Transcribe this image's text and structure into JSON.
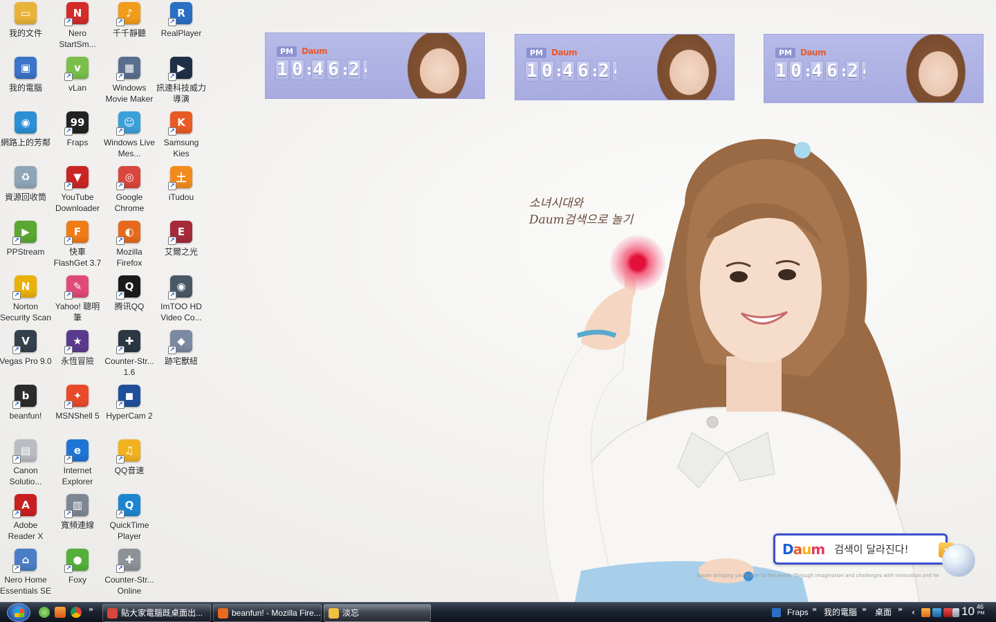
{
  "desktop": {
    "icons": [
      {
        "label": "我的文件",
        "icon": "my-documents-icon",
        "color": "#e9b33a",
        "glyph": "▭",
        "shortcut": false
      },
      {
        "label": "我的電腦",
        "icon": "my-computer-icon",
        "color": "#3b74c8",
        "glyph": "▣",
        "shortcut": false
      },
      {
        "label": "網路上的芳鄰",
        "icon": "network-places-icon",
        "color": "#2d8fd5",
        "glyph": "◉",
        "shortcut": false
      },
      {
        "label": "資源回收筒",
        "icon": "recycle-bin-icon",
        "color": "#8fa5b6",
        "glyph": "♻",
        "shortcut": false
      },
      {
        "label": "PPStream",
        "icon": "ppstream-icon",
        "color": "#5aa832",
        "glyph": "▶",
        "shortcut": true
      },
      {
        "label": "Norton Security Scan",
        "icon": "norton-icon",
        "color": "#e8b20a",
        "glyph": "N",
        "shortcut": true
      },
      {
        "label": "Vegas Pro 9.0",
        "icon": "vegas-icon",
        "color": "#35404d",
        "glyph": "V",
        "shortcut": true
      },
      {
        "label": "beanfun!",
        "icon": "beanfun-icon",
        "color": "#2b2b2b",
        "glyph": "b",
        "shortcut": true
      },
      {
        "label": "Canon Solutio...",
        "icon": "canon-icon",
        "color": "#b9bcc2",
        "glyph": "▤",
        "shortcut": true
      },
      {
        "label": "Adobe Reader X",
        "icon": "adobe-reader-icon",
        "color": "#c81f1f",
        "glyph": "A",
        "shortcut": true
      },
      {
        "label": "Nero Home Essentials SE",
        "icon": "nero-home-icon",
        "color": "#4a7ec7",
        "glyph": "⌂",
        "shortcut": true
      },
      {
        "label": "Nero StartSm...",
        "icon": "nero-icon",
        "color": "#d42b2b",
        "glyph": "N",
        "shortcut": true
      },
      {
        "label": "vLan",
        "icon": "vlan-icon",
        "color": "#7abf4a",
        "glyph": "v",
        "shortcut": true
      },
      {
        "label": "Fraps",
        "icon": "fraps-icon",
        "color": "#222222",
        "glyph": "99",
        "shortcut": true
      },
      {
        "label": "YouTube Downloader",
        "icon": "youtube-downloader-icon",
        "color": "#c92525",
        "glyph": "▼",
        "shortcut": true
      },
      {
        "label": "快車 FlashGet 3.7",
        "icon": "flashget-icon",
        "color": "#f07c16",
        "glyph": "F",
        "shortcut": true
      },
      {
        "label": "Yahoo! 聰明筆",
        "icon": "yahoo-pen-icon",
        "color": "#e04a7a",
        "glyph": "✎",
        "shortcut": true
      },
      {
        "label": "永恆冒險",
        "icon": "eternal-adventure-icon",
        "color": "#5a3a8c",
        "glyph": "★",
        "shortcut": true
      },
      {
        "label": "MSNShell 5",
        "icon": "msnshell-icon",
        "color": "#e84a2a",
        "glyph": "✦",
        "shortcut": true
      },
      {
        "label": "Internet Explorer",
        "icon": "internet-explorer-icon",
        "color": "#1f74d6",
        "glyph": "e",
        "shortcut": true
      },
      {
        "label": "寬頻連線",
        "icon": "broadband-icon",
        "color": "#7d8794",
        "glyph": "▥",
        "shortcut": true
      },
      {
        "label": "Foxy",
        "icon": "foxy-icon",
        "color": "#55b03a",
        "glyph": "●",
        "shortcut": true
      },
      {
        "label": "千千靜聽",
        "icon": "ttplayer-icon",
        "color": "#f29c1c",
        "glyph": "♪",
        "shortcut": true
      },
      {
        "label": "Windows Movie Maker",
        "icon": "movie-maker-icon",
        "color": "#5a6f8d",
        "glyph": "▦",
        "shortcut": true
      },
      {
        "label": "Windows Live Mes...",
        "icon": "live-messenger-icon",
        "color": "#3aa0d8",
        "glyph": "☺",
        "shortcut": true
      },
      {
        "label": "Google Chrome",
        "icon": "chrome-icon",
        "color": "#d9463b",
        "glyph": "◎",
        "shortcut": true
      },
      {
        "label": "Mozilla Firefox",
        "icon": "firefox-icon",
        "color": "#e66a1e",
        "glyph": "◐",
        "shortcut": true
      },
      {
        "label": "腾讯QQ",
        "icon": "qq-icon",
        "color": "#1b1b1b",
        "glyph": "Q",
        "shortcut": true
      },
      {
        "label": "Counter-Str... 1.6",
        "icon": "counter-strike-icon",
        "color": "#2c3744",
        "glyph": "✚",
        "shortcut": true
      },
      {
        "label": "HyperCam 2",
        "icon": "hypercam-icon",
        "color": "#1f4f9a",
        "glyph": "◼",
        "shortcut": true
      },
      {
        "label": "QQ音速",
        "icon": "qq-speed-icon",
        "color": "#f1b220",
        "glyph": "♫",
        "shortcut": true
      },
      {
        "label": "QuickTime Player",
        "icon": "quicktime-icon",
        "color": "#1d86d2",
        "glyph": "Q",
        "shortcut": true
      },
      {
        "label": "Counter-Str... Online",
        "icon": "cs-online-icon",
        "color": "#8d9298",
        "glyph": "✚",
        "shortcut": true
      },
      {
        "label": "RealPlayer",
        "icon": "realplayer-icon",
        "color": "#2a6fc4",
        "glyph": "R",
        "shortcut": true
      },
      {
        "label": "訊連科技威力導演",
        "icon": "powerdirector-icon",
        "color": "#1f2f45",
        "glyph": "▶",
        "shortcut": true
      },
      {
        "label": "Samsung Kies",
        "icon": "samsung-kies-icon",
        "color": "#ea5a25",
        "glyph": "K",
        "shortcut": true
      },
      {
        "label": "iTudou",
        "icon": "itudou-icon",
        "color": "#f28b1d",
        "glyph": "土",
        "shortcut": true
      },
      {
        "label": "艾爾之光",
        "icon": "elsword-icon",
        "color": "#a52b3a",
        "glyph": "E",
        "shortcut": true
      },
      {
        "label": "ImTOO HD Video Co...",
        "icon": "imtoo-icon",
        "color": "#4a5866",
        "glyph": "◉",
        "shortcut": true
      },
      {
        "label": "跡宅獸紐",
        "icon": "game-icon",
        "color": "#7b8aa2",
        "glyph": "◆",
        "shortcut": true
      }
    ]
  },
  "clocks": [
    {
      "ampm": "PM",
      "brand": "Daum",
      "time": [
        "1",
        "0",
        "4",
        "6",
        "2",
        "4"
      ]
    },
    {
      "ampm": "PM",
      "brand": "Daum",
      "time": [
        "1",
        "0",
        "4",
        "6",
        "2",
        "4"
      ]
    },
    {
      "ampm": "PM",
      "brand": "Daum",
      "time": [
        "1",
        "0",
        "4",
        "6",
        "2",
        "4"
      ]
    }
  ],
  "wallpaper": {
    "line1": "소녀시대와",
    "line2": "Daum검색으로 놀기",
    "search_logo": "Daum",
    "slogan": "검색이 달라진다!",
    "tagline": "Daum bringing you closer to the world. Through imagination and challenges with innovation and hea..."
  },
  "taskbar": {
    "tasks": [
      {
        "label": "貼大家電腦既桌面出...",
        "icon": "chrome-task-icon",
        "color": "#d9463b",
        "active": false
      },
      {
        "label": "beanfun! - Mozilla Fire...",
        "icon": "firefox-task-icon",
        "color": "#e66a1e",
        "active": false
      },
      {
        "label": "淡忘",
        "icon": "folder-task-icon",
        "color": "#f0c040",
        "active": true
      }
    ],
    "toolbars": [
      "Fraps",
      "我的電腦",
      "桌面"
    ],
    "clock": {
      "hour": "10",
      "minute": "46",
      "ampm": "PM"
    }
  },
  "colors": {
    "daum_d": "#1f5fd6",
    "daum_a": "#e85a2c",
    "daum_u": "#f2b51c",
    "daum_m": "#e23a5f"
  }
}
